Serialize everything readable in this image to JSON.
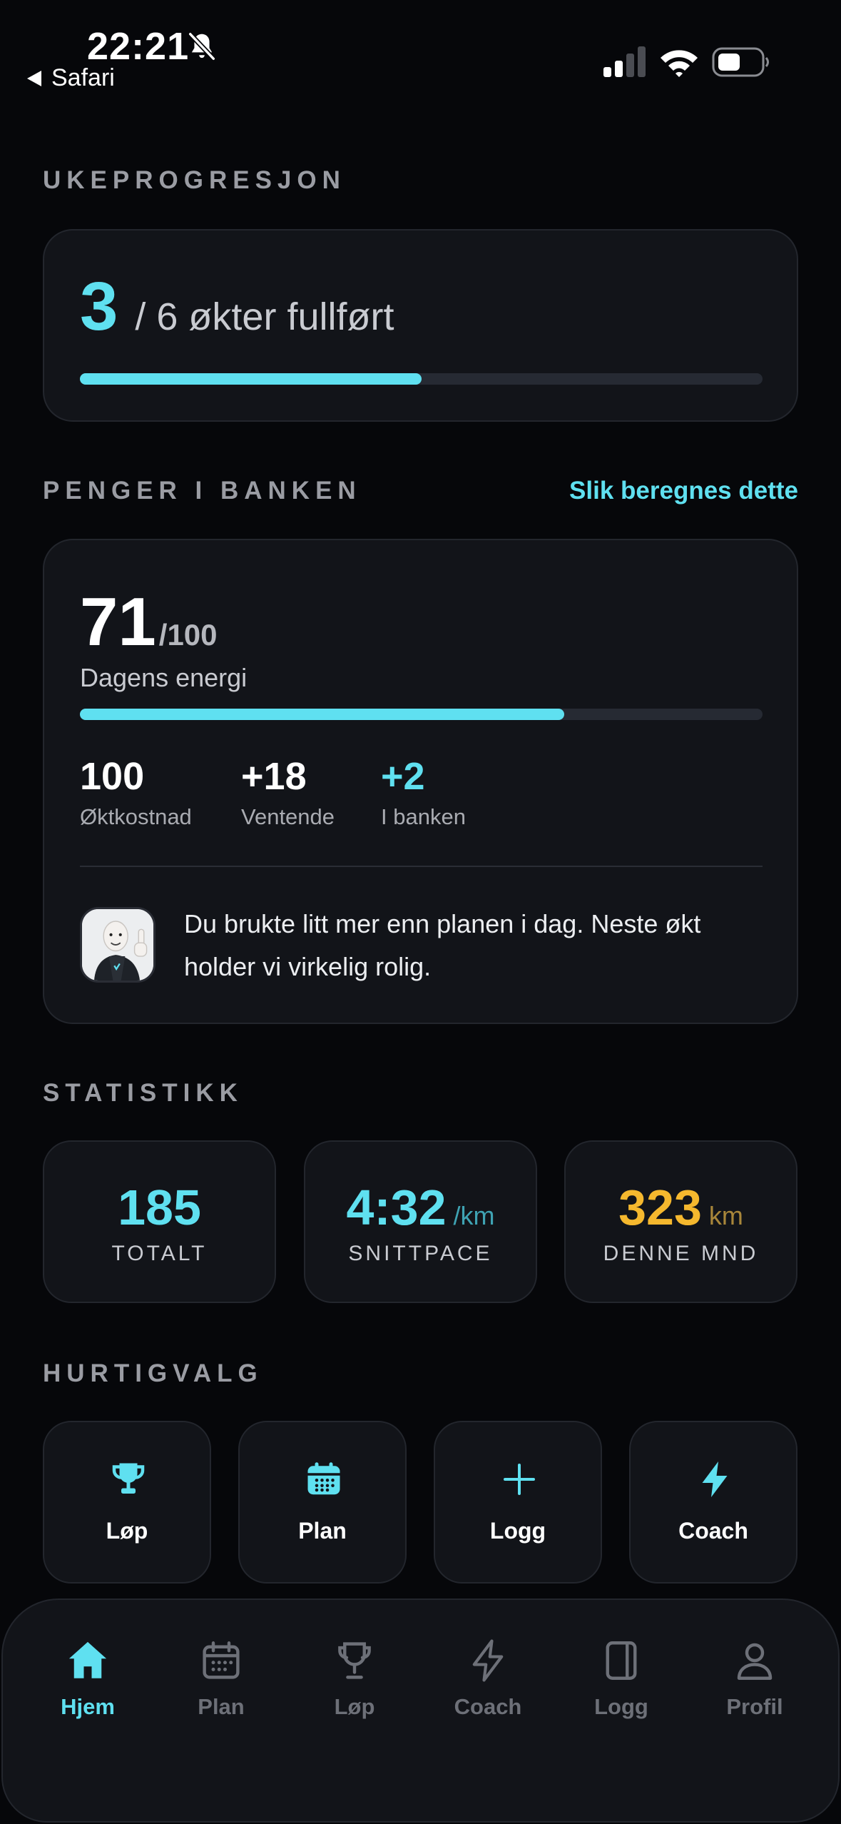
{
  "status_bar": {
    "time": "22:21",
    "back_label": "Safari"
  },
  "colors": {
    "accent": "#5fe0f0",
    "gold": "#f5b82e",
    "card": "#121419",
    "background": "#06070a"
  },
  "weekly": {
    "section_title": "UKEPROGRESJON",
    "completed": "3",
    "rest": "/ 6 økter fullført",
    "progress": 0.5
  },
  "bank": {
    "section_title": "PENGER I BANKEN",
    "link": "Slik beregnes dette",
    "energy": "71",
    "energy_max": "/100",
    "energy_label": "Dagens energi",
    "energy_progress": 0.71,
    "stats": [
      {
        "value": "100",
        "label": "Øktkostnad"
      },
      {
        "value": "+18",
        "label": "Ventende"
      },
      {
        "value": "+2",
        "label": "I banken"
      }
    ],
    "message": "Du brukte litt mer enn planen i dag. Neste økt holder vi virkelig rolig."
  },
  "stats": {
    "section_title": "STATISTIKK",
    "tiles": [
      {
        "value": "185",
        "unit": "",
        "label": "TOTALT"
      },
      {
        "value": "4:32",
        "unit": "/km",
        "label": "SNITTPACE"
      },
      {
        "value": "323",
        "unit": "km",
        "label": "DENNE MND"
      }
    ]
  },
  "quick": {
    "section_title": "HURTIGVALG",
    "items": [
      {
        "label": "Løp",
        "icon": "trophy-icon"
      },
      {
        "label": "Plan",
        "icon": "calendar-icon"
      },
      {
        "label": "Logg",
        "icon": "plus-icon"
      },
      {
        "label": "Coach",
        "icon": "bolt-icon"
      }
    ]
  },
  "tabs": [
    {
      "label": "Hjem",
      "icon": "home-icon",
      "active": true
    },
    {
      "label": "Plan",
      "icon": "calendar-icon"
    },
    {
      "label": "Løp",
      "icon": "trophy-icon"
    },
    {
      "label": "Coach",
      "icon": "bolt-icon"
    },
    {
      "label": "Logg",
      "icon": "book-icon"
    },
    {
      "label": "Profil",
      "icon": "person-icon"
    }
  ]
}
